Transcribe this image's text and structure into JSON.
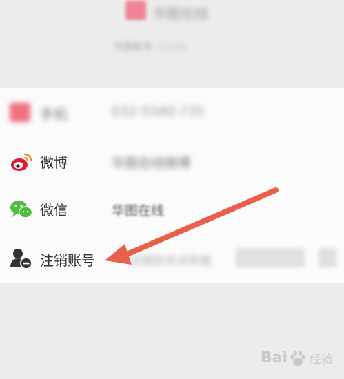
{
  "header": {
    "title": "华图在线",
    "subtitle_label": "华图账号",
    "subtitle_value": "12345"
  },
  "rows": [
    {
      "label": "手机",
      "value": "032-5580-735",
      "icon": "phone-icon"
    },
    {
      "label": "微博",
      "value": "华图在线微博",
      "icon": "weibo-icon"
    },
    {
      "label": "微信",
      "value": "华图在线",
      "icon": "wechat-icon"
    },
    {
      "label": "注销账号",
      "value": "注销后无法恢复",
      "icon": "user-remove-icon"
    }
  ],
  "watermark": {
    "brand_left": "Bai",
    "brand_right": "经验",
    "paw_icon": "baidu-paw-icon",
    "color": "#c9c9c9"
  },
  "annotation": {
    "arrow_color": "#e8604c"
  }
}
